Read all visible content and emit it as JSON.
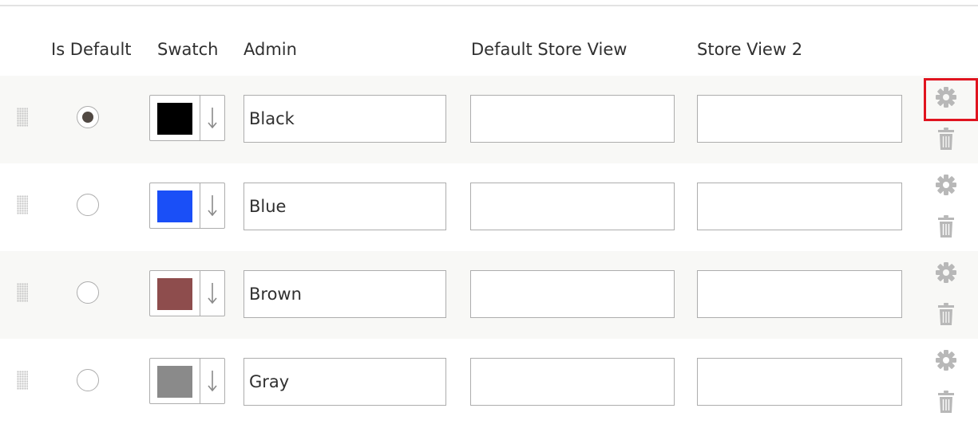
{
  "headers": {
    "is_default": "Is Default",
    "swatch": "Swatch",
    "admin": "Admin",
    "default_store_view": "Default Store View",
    "store_view_2": "Store View 2"
  },
  "rows": [
    {
      "is_default": true,
      "swatch_color": "#000000",
      "admin": "Black",
      "default_store_view": "",
      "store_view_2": ""
    },
    {
      "is_default": false,
      "swatch_color": "#1a4ff7",
      "admin": "Blue",
      "default_store_view": "",
      "store_view_2": ""
    },
    {
      "is_default": false,
      "swatch_color": "#8e4d4d",
      "admin": "Brown",
      "default_store_view": "",
      "store_view_2": ""
    },
    {
      "is_default": false,
      "swatch_color": "#8a8a8a",
      "admin": "Gray",
      "default_store_view": "",
      "store_view_2": ""
    }
  ],
  "icons": {
    "drag": "drag-handle-icon",
    "swatch_arrow": "arrow-down-icon",
    "settings": "gear-icon",
    "delete": "trash-icon"
  },
  "colors": {
    "highlight": "#e0141f",
    "shaded_row": "#f8f8f6",
    "icon": "#b8b8b8"
  }
}
